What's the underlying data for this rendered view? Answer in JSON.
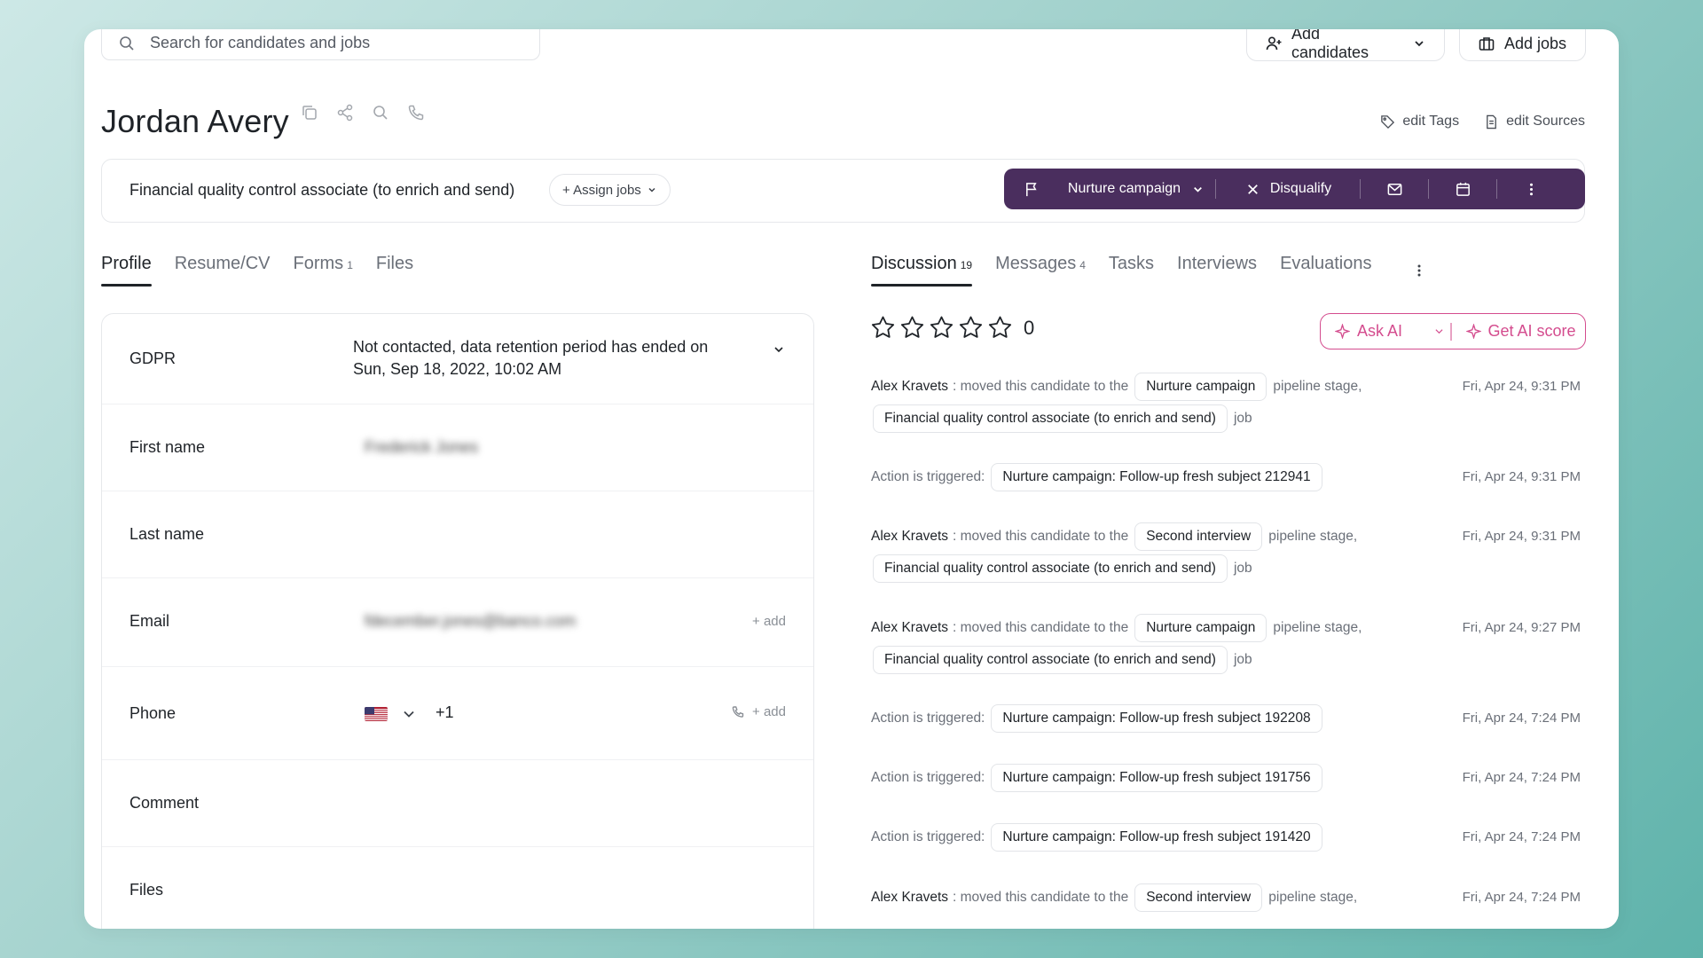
{
  "search": {
    "placeholder": "Search for candidates and jobs"
  },
  "topbar": {
    "add_candidates": "Add candidates",
    "add_jobs": "Add jobs"
  },
  "candidate": {
    "name": "Jordan Avery"
  },
  "header_links": {
    "edit_tags": "edit Tags",
    "edit_sources": "edit Sources"
  },
  "job": {
    "title": "Financial quality control associate (to enrich and send)",
    "assign_label": "+ Assign jobs",
    "stage": "Nurture campaign",
    "disqualify": "Disqualify"
  },
  "left_tabs": [
    {
      "label": "Profile",
      "count": ""
    },
    {
      "label": "Resume/CV",
      "count": ""
    },
    {
      "label": "Forms",
      "count": "1"
    },
    {
      "label": "Files",
      "count": ""
    }
  ],
  "right_tabs": [
    {
      "label": "Discussion",
      "count": "19"
    },
    {
      "label": "Messages",
      "count": "4"
    },
    {
      "label": "Tasks",
      "count": ""
    },
    {
      "label": "Interviews",
      "count": ""
    },
    {
      "label": "Evaluations",
      "count": ""
    }
  ],
  "profile": {
    "gdpr_label": "GDPR",
    "gdpr_value_line1": "Not contacted, data retention period has ended on",
    "gdpr_value_line2": "Sun, Sep 18, 2022, 10:02 AM",
    "first_name_label": "First name",
    "first_name_value": "Frederick Jones",
    "last_name_label": "Last name",
    "email_label": "Email",
    "email_value": "fdecember.jones@banco.com",
    "phone_label": "Phone",
    "phone_code": "+1",
    "comment_label": "Comment",
    "files_label": "Files",
    "add_label": "+ add"
  },
  "rating": {
    "value": 0,
    "max": 5,
    "count_label": "0"
  },
  "ai": {
    "ask": "Ask AI",
    "score": "Get AI score"
  },
  "accent_colors": {
    "action_bar": "#4a2e5e",
    "ai": "#d44c8e"
  },
  "feed": {
    "moved_text": "moved this candidate to the",
    "stage_suffix": "pipeline stage,",
    "job_suffix": "job",
    "action_text": "Action is triggered:",
    "entries": [
      {
        "type": "move",
        "author": "Alex Kravets",
        "stage": "Nurture campaign",
        "job": "Financial quality control associate (to enrich and send)",
        "time": "Fri, Apr 24, 9:31 PM"
      },
      {
        "type": "action",
        "chip": "Nurture campaign: Follow-up fresh subject 212941",
        "time": "Fri, Apr 24, 9:31 PM"
      },
      {
        "type": "move",
        "author": "Alex Kravets",
        "stage": "Second interview",
        "job": "Financial quality control associate (to enrich and send)",
        "time": "Fri, Apr 24, 9:31 PM"
      },
      {
        "type": "move",
        "author": "Alex Kravets",
        "stage": "Nurture campaign",
        "job": "Financial quality control associate (to enrich and send)",
        "time": "Fri, Apr 24, 9:27 PM"
      },
      {
        "type": "action",
        "chip": "Nurture campaign: Follow-up fresh subject 192208",
        "time": "Fri, Apr 24, 7:24 PM"
      },
      {
        "type": "action",
        "chip": "Nurture campaign: Follow-up fresh subject 191756",
        "time": "Fri, Apr 24, 7:24 PM"
      },
      {
        "type": "action",
        "chip": "Nurture campaign: Follow-up fresh subject 191420",
        "time": "Fri, Apr 24, 7:24 PM"
      },
      {
        "type": "move",
        "author": "Alex Kravets",
        "stage": "Second interview",
        "job": "",
        "time": "Fri, Apr 24, 7:24 PM"
      }
    ]
  }
}
